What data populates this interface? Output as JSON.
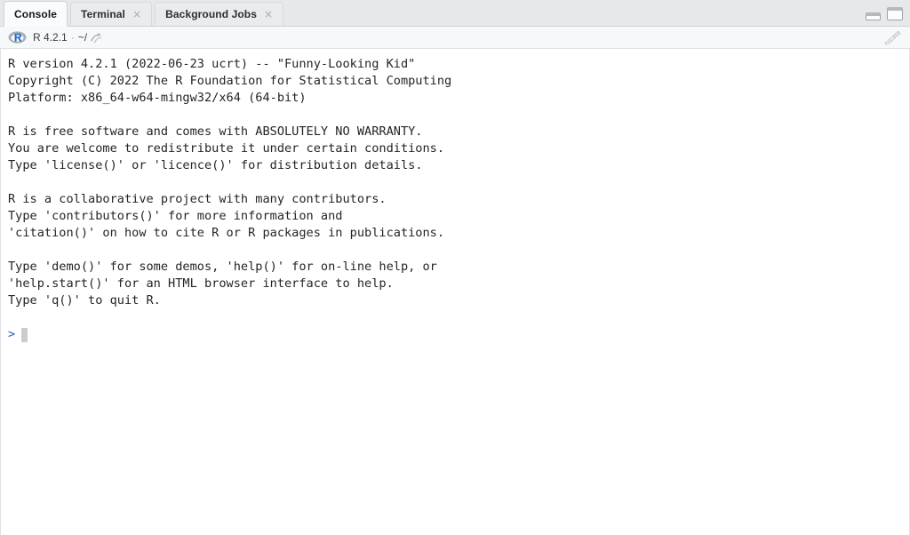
{
  "window": {
    "minimize_icon": "minimize-icon",
    "maximize_icon": "maximize-icon"
  },
  "tabs": [
    {
      "label": "Console",
      "active": true,
      "closable": false
    },
    {
      "label": "Terminal",
      "active": false,
      "closable": true,
      "close_glyph": "×"
    },
    {
      "label": "Background Jobs",
      "active": false,
      "closable": true,
      "close_glyph": "×"
    }
  ],
  "console_header": {
    "logo_letter": "R",
    "version": "R 4.2.1",
    "separator": "·",
    "path": "~/",
    "popout_icon": "popout-arrow-icon",
    "clear_icon": "broom-icon"
  },
  "console": {
    "output": "R version 4.2.1 (2022-06-23 ucrt) -- \"Funny-Looking Kid\"\nCopyright (C) 2022 The R Foundation for Statistical Computing\nPlatform: x86_64-w64-mingw32/x64 (64-bit)\n\nR is free software and comes with ABSOLUTELY NO WARRANTY.\nYou are welcome to redistribute it under certain conditions.\nType 'license()' or 'licence()' for distribution details.\n\nR is a collaborative project with many contributors.\nType 'contributors()' for more information and\n'citation()' on how to cite R or R packages in publications.\n\nType 'demo()' for some demos, 'help()' for on-line help, or\n'help.start()' for an HTML browser interface to help.\nType 'q()' to quit R.",
    "prompt": ">",
    "input_value": ""
  },
  "colors": {
    "prompt_blue": "#1d5fbd",
    "logo_blue": "#276dc3",
    "text": "#212529",
    "tabstrip_bg": "#e6e8ea",
    "active_tab_bg": "#fafbfc",
    "console_bg": "#ffffff"
  }
}
